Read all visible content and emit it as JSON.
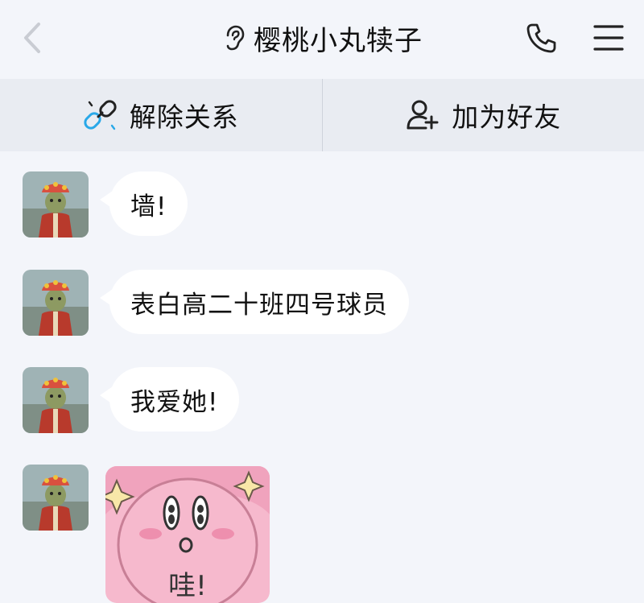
{
  "header": {
    "title": "樱桃小丸犊子",
    "icons": [
      "back-arrow-icon",
      "ear-icon",
      "phone-icon",
      "menu-icon"
    ]
  },
  "actions": [
    {
      "label": "解除关系",
      "icon": "broken-link-icon"
    },
    {
      "label": "加为好友",
      "icon": "add-friend-icon"
    }
  ],
  "messages": [
    {
      "text": "墙!"
    },
    {
      "text": "表白高二十班四号球员"
    },
    {
      "text": "我爱她!"
    },
    {
      "sticker": "kirby-sticker",
      "sticker_text": "哇!"
    }
  ],
  "colors": {
    "background": "#f3f5fa",
    "action_bar": "#e9ecf2",
    "bubble": "#ffffff",
    "link_icon_accent": "#29a8e8",
    "sticker_pink": "#f6b9cd"
  }
}
